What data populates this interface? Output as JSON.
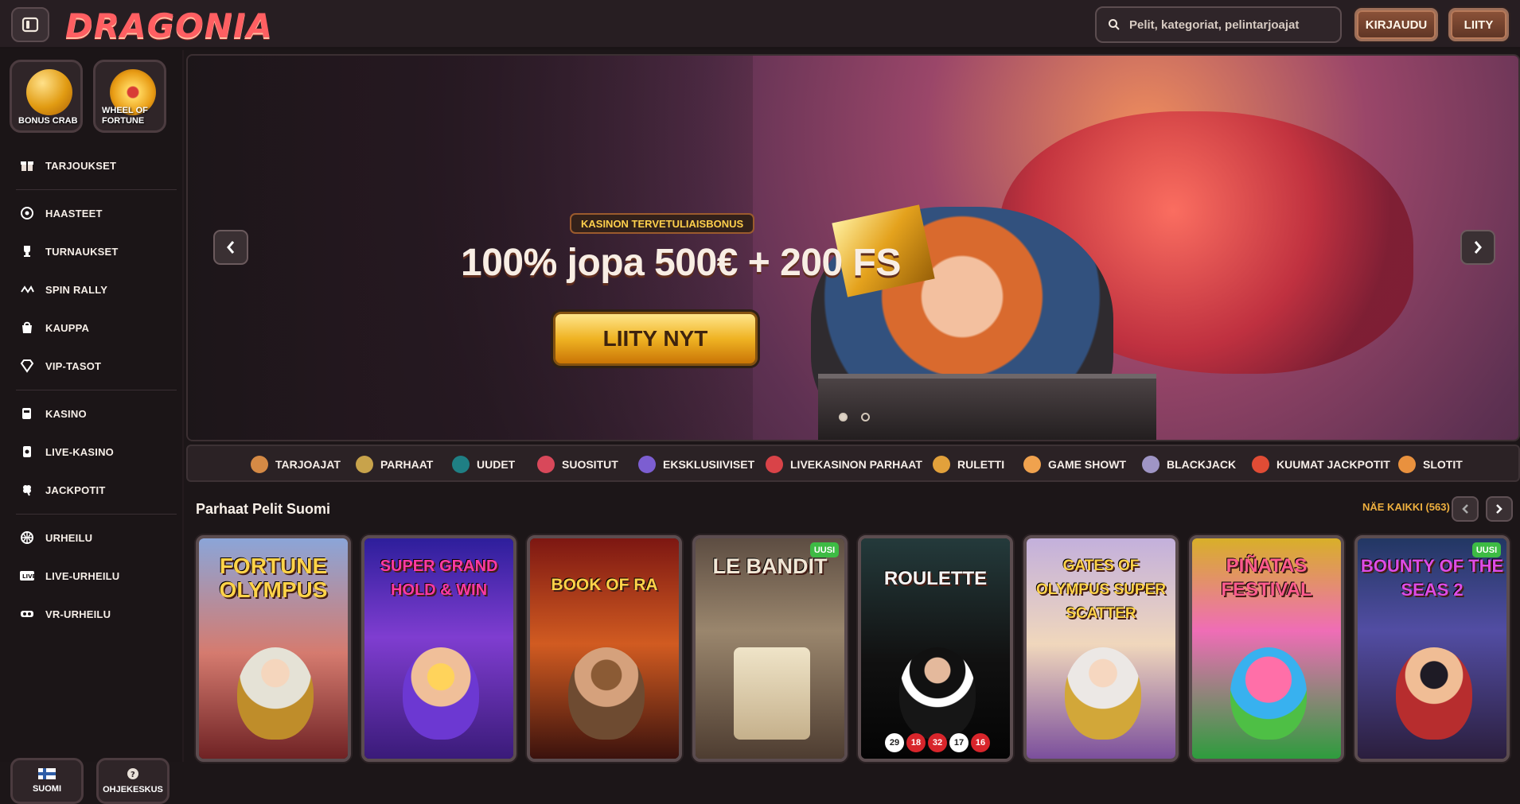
{
  "brand": {
    "logo_text": "DRAGONIA"
  },
  "header": {
    "search_placeholder": "Pelit, kategoriat, pelintarjoajat",
    "login_label": "KIRJAUDU",
    "join_label": "LIITY"
  },
  "sidebar": {
    "feature_tiles": [
      {
        "label": "BONUS CRAB",
        "icon": "crab-orb-icon"
      },
      {
        "label": "WHEEL OF FORTUNE",
        "icon": "wheel-of-fortune-icon"
      }
    ],
    "items": [
      {
        "label": "TARJOUKSET",
        "icon": "gift-icon"
      },
      {
        "label": "HAASTEET",
        "icon": "target-icon"
      },
      {
        "label": "TURNAUKSET",
        "icon": "trophy-icon"
      },
      {
        "label": "SPIN RALLY",
        "icon": "rally-icon"
      },
      {
        "label": "KAUPPA",
        "icon": "shopping-bag-icon"
      },
      {
        "label": "VIP-TASOT",
        "icon": "diamond-icon"
      },
      {
        "label": "KASINO",
        "icon": "slot-machine-icon"
      },
      {
        "label": "LIVE-KASINO",
        "icon": "live-card-icon"
      },
      {
        "label": "JACKPOTIT",
        "icon": "clover-icon"
      },
      {
        "label": "URHEILU",
        "icon": "basketball-icon"
      },
      {
        "label": "LIVE-URHEILU",
        "icon": "live-badge-icon"
      },
      {
        "label": "VR-URHEILU",
        "icon": "vr-headset-icon"
      }
    ],
    "bottom_buttons": [
      {
        "label": "SUOMI",
        "icon": "finland-flag-icon"
      },
      {
        "label": "OHJEKESKUS",
        "icon": "help-icon"
      }
    ]
  },
  "hero": {
    "badge": "KASINON TERVETULIAISBONUS",
    "headline": "100% jopa 500€ + 200 FS",
    "cta": "LIITY NYT"
  },
  "categories": [
    {
      "label": "TARJOAJAT",
      "icon": "provider-icon",
      "color": "#d58a45"
    },
    {
      "label": "PARHAAT",
      "icon": "star-icon",
      "color": "#c8a34b"
    },
    {
      "label": "UUDET",
      "icon": "egg-icon",
      "color": "#1f7f84"
    },
    {
      "label": "SUOSITUT",
      "icon": "rocket-icon",
      "color": "#d8485a"
    },
    {
      "label": "EKSKLUSIIVISET",
      "icon": "gem-icon",
      "color": "#7c5ed1"
    },
    {
      "label": "LIVEKASINON PARHAAT",
      "icon": "casino-chip-icon",
      "color": "#d94348"
    },
    {
      "label": "RULETTI",
      "icon": "roulette-icon",
      "color": "#e2a13b"
    },
    {
      "label": "GAME SHOWT",
      "icon": "game-show-icon",
      "color": "#f0a24e"
    },
    {
      "label": "BLACKJACK",
      "icon": "cards-icon",
      "color": "#9f95c5"
    },
    {
      "label": "KUUMAT JACKPOTIT",
      "icon": "hot-jackpot-icon",
      "color": "#e14c35"
    },
    {
      "label": "SLOTIT",
      "icon": "slot-icon",
      "color": "#e9913e"
    }
  ],
  "section": {
    "title": "Parhaat Pelit Suomi",
    "see_all": "NÄE KAIKKI (563)"
  },
  "games": [
    {
      "title": "FORTUNE OLYMPUS",
      "badge": "",
      "color": "#c93d43"
    },
    {
      "title": "SUPER GRAND HOLD & WIN",
      "badge": "",
      "color": "#4a2da8"
    },
    {
      "title": "BOOK OF RA",
      "badge": "",
      "color": "#7a2116"
    },
    {
      "title": "LE BANDIT",
      "badge": "UUSI",
      "color": "#5b4637"
    },
    {
      "title": "ROULETTE",
      "badge": "",
      "color": "#1f2e2b"
    },
    {
      "title": "GATES OF OLYMPUS SUPER SCATTER",
      "badge": "",
      "color": "#7455a6"
    },
    {
      "title": "PIÑATAS FESTIVAL",
      "badge": "",
      "color": "#d9b53f"
    },
    {
      "title": "BOUNTY OF THE SEAS 2",
      "badge": "UUSI",
      "color": "#3f3580"
    }
  ]
}
